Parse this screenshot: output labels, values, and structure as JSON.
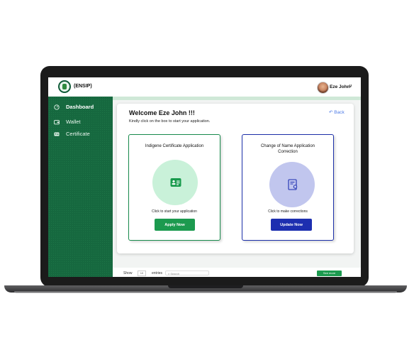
{
  "app": {
    "brand": "(ENSIP)"
  },
  "user": {
    "name": "Eze John"
  },
  "sidebar": {
    "items": [
      {
        "label": "Dashboard",
        "icon": "gauge-icon",
        "active": true
      },
      {
        "label": "Wallet",
        "icon": "wallet-icon",
        "active": false
      },
      {
        "label": "Certificate",
        "icon": "id-card-icon",
        "active": false
      }
    ]
  },
  "main": {
    "welcome": "Welcome Eze John !!!",
    "subtitle": "Kindly click on the box to start your application.",
    "back_label": "Back",
    "cards": [
      {
        "title": "Indigene Certificate Application",
        "hint": "Click to start your application",
        "button": "Apply Now",
        "icon": "id-card-icon"
      },
      {
        "title": "Change of Name Application Correction",
        "hint": "Click to make corrections",
        "button": "Update Now",
        "icon": "certificate-icon"
      }
    ]
  },
  "table": {
    "show_label": "Show",
    "show_value": "10",
    "entries_label": "entries",
    "search_placeholder": "Search",
    "see_more": "See more"
  },
  "colors": {
    "sidebar": "#16683f",
    "primary_green": "#1c9a4f",
    "primary_blue": "#1d2fb0",
    "link_blue": "#4e7be6"
  }
}
